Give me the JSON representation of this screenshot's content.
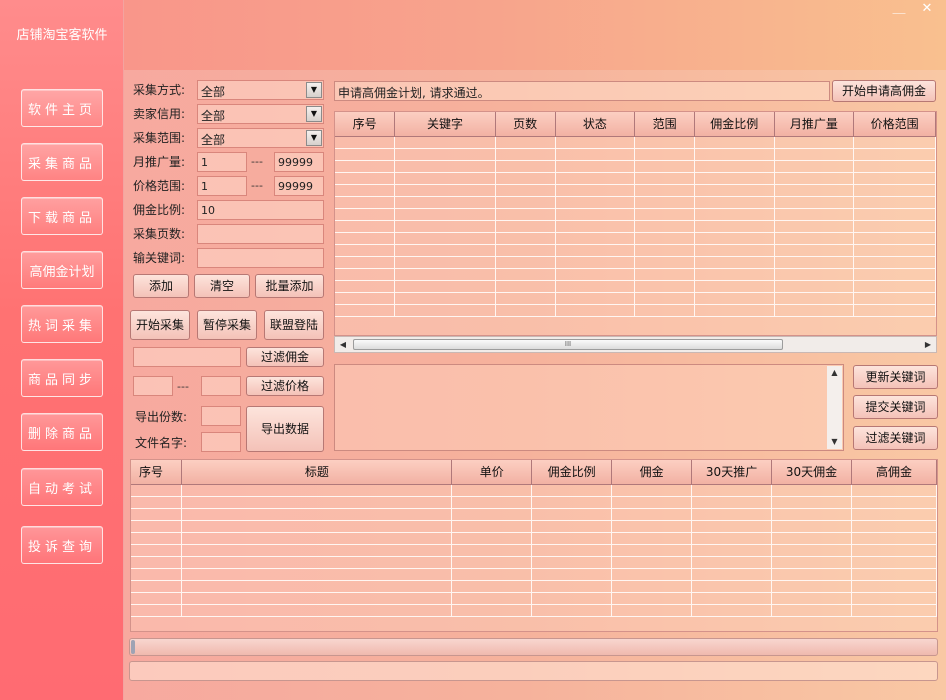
{
  "app": {
    "brand": "店铺淘宝客软件",
    "min_icon": "minimize-icon",
    "close_icon": "close-icon",
    "min_glyph": "＿",
    "close_glyph": "✕"
  },
  "sidebar": {
    "items": [
      {
        "label": "软件主页"
      },
      {
        "label": "采集商品"
      },
      {
        "label": "下载商品"
      },
      {
        "label": "高佣金计划"
      },
      {
        "label": "热词采集"
      },
      {
        "label": "商品同步"
      },
      {
        "label": "删除商品"
      },
      {
        "label": "自动考试"
      },
      {
        "label": "投诉查询"
      }
    ]
  },
  "form": {
    "collect_mode_label": "采集方式:",
    "collect_mode_value": "全部",
    "seller_credit_label": "卖家信用:",
    "seller_credit_value": "全部",
    "collect_range_label": "采集范围:",
    "collect_range_value": "全部",
    "monthly_promo_label": "月推广量:",
    "monthly_promo_min": "1",
    "monthly_promo_max": "99999",
    "price_range_label": "价格范围:",
    "price_min": "1",
    "price_max": "99999",
    "commission_label": "佣金比例:",
    "commission_value": "10",
    "pages_label": "采集页数:",
    "pages_value": "",
    "keyword_label": "输关键词:",
    "keyword_value": "",
    "range_sep": "---",
    "dropdown_glyph": "▼"
  },
  "buttons": {
    "add": "添加",
    "clear": "清空",
    "batch_add": "批量添加",
    "start_collect": "开始采集",
    "pause_collect": "暂停采集",
    "alliance_login": "联盟登陆",
    "filter_commission": "过滤佣金",
    "filter_price": "过滤价格",
    "export_data": "导出数据",
    "apply_high_commission": "开始申请高佣金",
    "update_keywords": "更新关键词",
    "submit_keywords": "提交关键词",
    "filter_keywords": "过滤关键词"
  },
  "filters": {
    "commission_filter_value": "",
    "price_filter_min": "",
    "price_filter_max": "",
    "export_count_label": "导出份数:",
    "export_count_value": "",
    "file_name_label": "文件名字:",
    "file_name_value": ""
  },
  "notice": {
    "text": "申请高佣金计划, 请求通过。"
  },
  "plan_table": {
    "columns": [
      "序号",
      "关键字",
      "页数",
      "状态",
      "范围",
      "佣金比例",
      "月推广量",
      "价格范围"
    ],
    "rows": []
  },
  "scrollbar": {
    "left_glyph": "◀",
    "right_glyph": "▶",
    "thumb_glyph": "III",
    "up_glyph": "▲",
    "down_glyph": "▼"
  },
  "keyword_memo": {
    "text": ""
  },
  "product_table": {
    "columns": [
      "序号",
      "标题",
      "单价",
      "佣金比例",
      "佣金",
      "30天推广",
      "30天佣金",
      "高佣金"
    ],
    "rows": []
  },
  "progress": {
    "value": 0.005
  },
  "status_bar": {
    "text": ""
  }
}
